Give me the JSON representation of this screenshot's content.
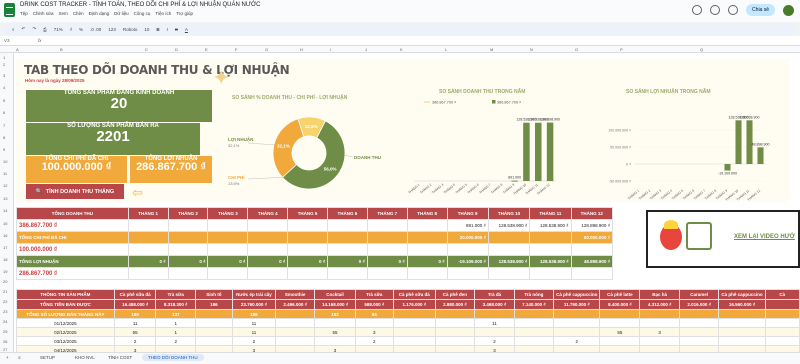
{
  "window": {
    "title": "DRINK COST TRACKER - TÍNH TOÁN, THEO DÕI CHI PHÍ & LỢI NHUẬN QUÁN NƯỚC",
    "menu": [
      "Tệp",
      "Chỉnh sửa",
      "Xem",
      "Chèn",
      "Định dạng",
      "Dữ liệu",
      "Công cụ",
      "Tiện ích",
      "Trợ giúp"
    ],
    "share_label": "Chia sẻ"
  },
  "toolbar": {
    "zoom": "71%",
    "currency": "₫",
    "percent": "%",
    "decimals": ".0 .00",
    "number_format": "123",
    "font": "Roboto",
    "font_size": "10"
  },
  "formula_bar": {
    "cell_ref": "V3",
    "fx": "fx"
  },
  "columns": [
    "A",
    "B",
    "C",
    "D",
    "E",
    "F",
    "G",
    "H",
    "I",
    "J",
    "K",
    "L",
    "M",
    "N",
    "O",
    "P",
    "Q"
  ],
  "rows": [
    "1",
    "2",
    "3",
    "4",
    "5",
    "6",
    "7",
    "8",
    "9",
    "10",
    "11",
    "12",
    "13",
    "14",
    "15",
    "16",
    "17",
    "18",
    "19",
    "20",
    "21",
    "22",
    "23",
    "24",
    "25",
    "26",
    "27",
    "28"
  ],
  "dashboard": {
    "title": "TAB THEO DÕI DOANH THU & LỢI NHUẬN",
    "date_label": "Hôm nay là ngày 28/09/2025",
    "kpis": {
      "products_label": "TỔNG SẢN PHẨM ĐANG KINH DOANH",
      "products_value": "20",
      "sold_label": "SỐ LƯỢNG SẢN PHẨM BÁN RA",
      "sold_value": "2201",
      "cost_label": "TỔNG CHI PHÍ ĐÃ CHI",
      "cost_value": "100.000.000 ₫",
      "profit_label": "TỔNG LỢI NHUẬN",
      "profit_value": "286.867.700 ₫"
    },
    "calc_button": "TÍNH DOANH THU THÁNG"
  },
  "chart_data": [
    {
      "type": "pie",
      "title": "SO SÁNH % DOANH THU - CHI PHÍ - LỢI NHUẬN",
      "categories": [
        "DOANH THU",
        "LỢI NHUẬN",
        "CHI PHÍ"
      ],
      "values": [
        56.0,
        32.1,
        12.5
      ],
      "labels_on_slices": [
        "56,0%",
        "32,1%",
        "12,5%"
      ],
      "outer_labels": {
        "LỢI NHUẬN": "32,1%",
        "CHI PHÍ": "13,5%"
      },
      "colors": [
        "#6f8d46",
        "#f2a93b",
        "#f7d36b"
      ]
    },
    {
      "type": "bar",
      "title": "SO SÁNH DOANH THU TRONG NĂM",
      "legend": [
        "386.867.700 ₫"
      ],
      "legend_placement": "top",
      "categories": [
        "THÁNG 1",
        "THÁNG 2",
        "THÁNG 3",
        "THÁNG 4",
        "THÁNG 5",
        "THÁNG 6",
        "THÁNG 7",
        "THÁNG 8",
        "THÁNG 9",
        "THÁNG 10",
        "THÁNG 11",
        "THÁNG 12"
      ],
      "values": [
        0,
        0,
        0,
        0,
        0,
        0,
        0,
        0,
        891000,
        128538900,
        128538900,
        128898900
      ],
      "data_labels": [
        "",
        "",
        "",
        "",
        "",
        "",
        "",
        "",
        "891.000",
        "128.538.900",
        "128.538.900",
        "128.898.900"
      ],
      "ylim": [
        0,
        150000000
      ],
      "color": "#6f8d46"
    },
    {
      "type": "bar",
      "title": "SO SÁNH LỢI NHUẬN TRONG NĂM",
      "categories": [
        "THÁNG 1",
        "THÁNG 2",
        "THÁNG 3",
        "THÁNG 4",
        "THÁNG 5",
        "THÁNG 6",
        "THÁNG 7",
        "THÁNG 8",
        "THÁNG 9",
        "THÁNG 10",
        "THÁNG 11",
        "THÁNG 12"
      ],
      "values": [
        0,
        0,
        0,
        0,
        0,
        0,
        0,
        0,
        -19109000,
        128538900,
        128538900,
        48898900
      ],
      "data_labels": [
        "",
        "",
        "",
        "",
        "",
        "",
        "",
        "",
        "-19.109.000",
        "128.538.900",
        "128.538.900",
        "48.898.900"
      ],
      "ylim": [
        -50000000,
        150000000
      ],
      "yticks": [
        "100.000.000 ₫",
        "50.000.000 ₫",
        "0 ₫",
        "-50.000.000 ₫"
      ],
      "color": "#6f8d46"
    }
  ],
  "monthly_table": {
    "months": [
      "THÁNG 1",
      "THÁNG 2",
      "THÁNG 3",
      "THÁNG 4",
      "THÁNG 5",
      "THÁNG 6",
      "THÁNG 7",
      "THÁNG 8",
      "THÁNG 9",
      "THÁNG 10",
      "THÁNG 11",
      "THÁNG 12"
    ],
    "revenue_label": "TỔNG DOANH THU",
    "revenue_total": "386.867.700 ₫",
    "revenue": [
      "",
      "",
      "",
      "",
      "",
      "",
      "",
      "",
      "891.000 ₫",
      "128.538.900 ₫",
      "128.538.900 ₫",
      "128.898.900 ₫"
    ],
    "cost_label": "TỔNG CHI PHÍ ĐÃ CHI",
    "cost_total": "100.000.000 ₫",
    "cost": [
      "",
      "",
      "",
      "",
      "",
      "",
      "",
      "",
      "20.000.000 ₫",
      "",
      "",
      "80.000.000 ₫"
    ],
    "profit_label": "TỔNG LỢI NHUẬN",
    "profit_total": "286.867.700 ₫",
    "profit": [
      "0 ₫",
      "0 ₫",
      "0 ₫",
      "0 ₫",
      "0 ₫",
      "0 ₫",
      "0 ₫",
      "0 ₫",
      "-19.109.000 ₫",
      "128.538.900 ₫",
      "128.538.900 ₫",
      "48.898.900 ₫"
    ]
  },
  "video_link": "XEM LẠI VIDEO HƯỚ",
  "product_table": {
    "header_label": "THÔNG TIN SẢN PHẨM",
    "products": [
      "Cà phê sữa đá",
      "Trà sữa",
      "Sinh tố",
      "Nước ép trái cây",
      "Smoothie",
      "Cocktail",
      "Trà sữa",
      "Cà phê sữa đá",
      "Cà phê đen",
      "Trà đá",
      "Trà nóng",
      "Cà phê cappuccino",
      "Cà phê latte",
      "Bạc hà",
      "Caramel",
      "Cà phê cappuccino",
      "Cà"
    ],
    "revenue_label": "TỔNG TIỀN BÁN ĐƯỢC",
    "revenue": [
      "16.488.000 ₫",
      "8.318.300 ₫",
      "186",
      "23.760.000 ₫",
      "2.496.000 ₫",
      "14.168.000 ₫",
      "588.000 ₫",
      "1.176.000 ₫",
      "2.880.000 ₫",
      "3.468.000 ₫",
      "7.140.000 ₫",
      "11.790.000 ₫",
      "8.400.000 ₫",
      "4.312.000 ₫",
      "2.016.000 ₫",
      "16.560.000 ₫",
      ""
    ],
    "qty_label": "TỔNG SỐ LƯỢNG BÁN THÁNG NÀY",
    "qty": [
      "180",
      "137",
      "",
      "186",
      "",
      "152",
      "84",
      "",
      "",
      "",
      "",
      "",
      "",
      "",
      "",
      "",
      ""
    ],
    "rows": [
      {
        "date": "01/12/2025",
        "vals": [
          "11",
          "1",
          "",
          "11",
          "",
          "",
          "",
          "",
          "",
          "11",
          "",
          "",
          "",
          "",
          "",
          "",
          ""
        ]
      },
      {
        "date": "02/12/2025",
        "vals": [
          "55",
          "1",
          "",
          "11",
          "",
          "55",
          "3",
          "",
          "",
          "",
          "",
          "",
          "55",
          "3",
          "",
          "",
          ""
        ]
      },
      {
        "date": "03/12/2025",
        "vals": [
          "2",
          "2",
          "",
          "2",
          "",
          "",
          "2",
          "",
          "",
          "2",
          "",
          "2",
          "",
          "",
          "",
          "",
          ""
        ]
      },
      {
        "date": "04/12/2025",
        "vals": [
          "3",
          "",
          "",
          "3",
          "",
          "3",
          "",
          "",
          "",
          "3",
          "",
          "",
          "",
          "",
          "",
          "",
          ""
        ]
      }
    ]
  },
  "sheet_tabs": [
    "SETUP",
    "KHO NVL",
    "TÍNH COST",
    "THEO DÕI DOANH THU"
  ],
  "active_tab": "THEO DÕI DOANH THU"
}
